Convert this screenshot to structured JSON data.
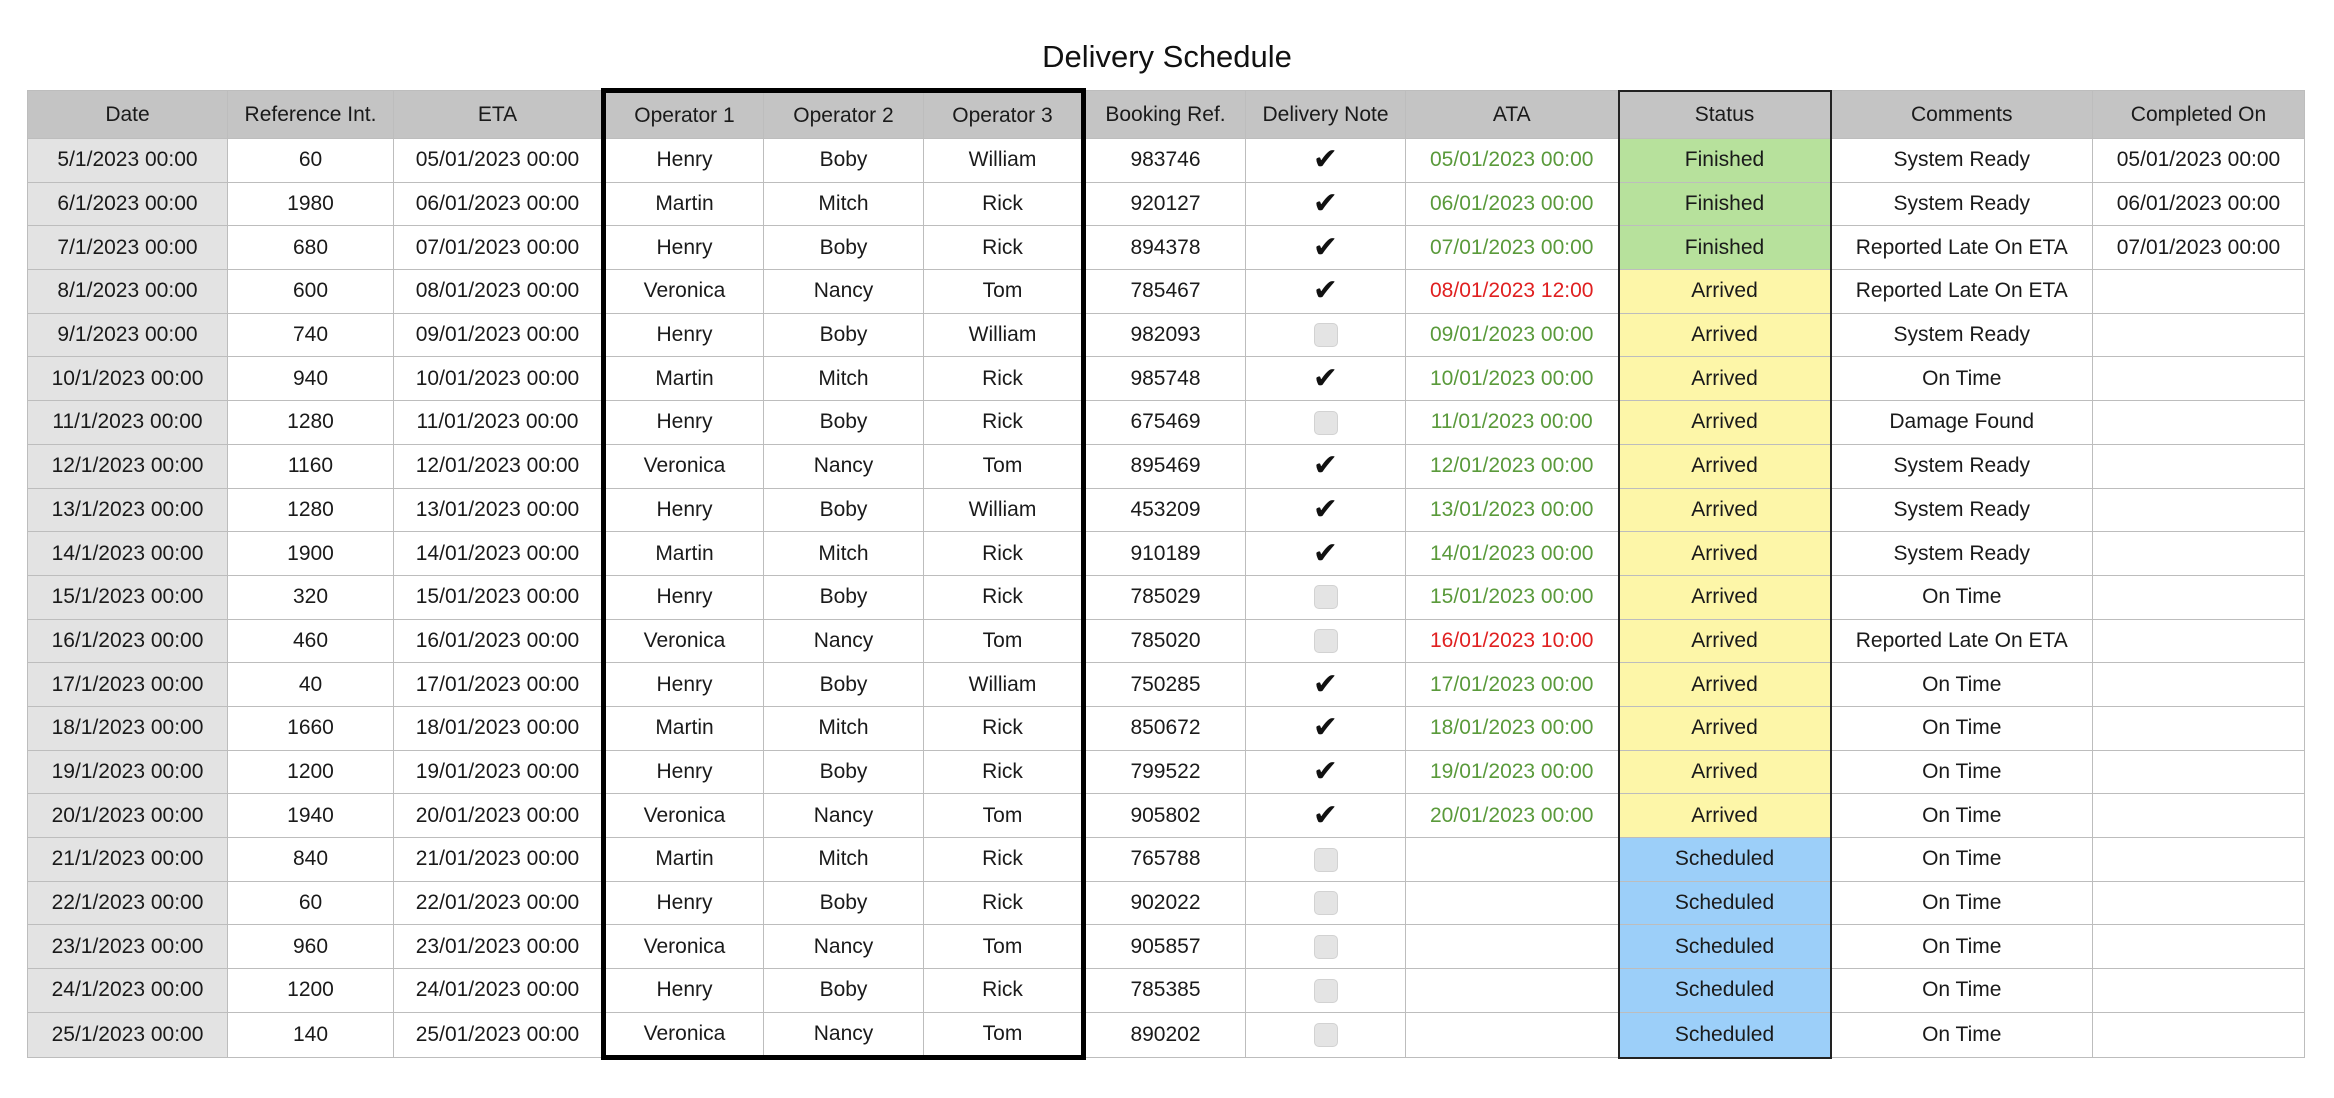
{
  "title": "Delivery Schedule",
  "columns": [
    "Date",
    "Reference Int.",
    "ETA",
    "Operator 1",
    "Operator 2",
    "Operator 3",
    "Booking Ref.",
    "Delivery Note",
    "ATA",
    "Status",
    "Comments",
    "Completed On"
  ],
  "status_colors": {
    "Finished": "#b7e19c",
    "Arrived": "#fdf6a8",
    "Scheduled": "#9ccff9"
  },
  "ata_colors": {
    "ontime": "#5a9a3b",
    "late": "#e02020"
  },
  "rows": [
    {
      "date": "5/1/2023 00:00",
      "ref": "60",
      "eta": "05/01/2023 00:00",
      "op1": "Henry",
      "op2": "Boby",
      "op3": "William",
      "booking": "983746",
      "note": true,
      "ata": "05/01/2023 00:00",
      "ata_state": "ontime",
      "status": "Finished",
      "comment": "System Ready",
      "completed": "05/01/2023 00:00"
    },
    {
      "date": "6/1/2023 00:00",
      "ref": "1980",
      "eta": "06/01/2023 00:00",
      "op1": "Martin",
      "op2": "Mitch",
      "op3": "Rick",
      "booking": "920127",
      "note": true,
      "ata": "06/01/2023 00:00",
      "ata_state": "ontime",
      "status": "Finished",
      "comment": "System Ready",
      "completed": "06/01/2023 00:00"
    },
    {
      "date": "7/1/2023 00:00",
      "ref": "680",
      "eta": "07/01/2023 00:00",
      "op1": "Henry",
      "op2": "Boby",
      "op3": "Rick",
      "booking": "894378",
      "note": true,
      "ata": "07/01/2023 00:00",
      "ata_state": "ontime",
      "status": "Finished",
      "comment": "Reported Late On ETA",
      "completed": "07/01/2023 00:00"
    },
    {
      "date": "8/1/2023 00:00",
      "ref": "600",
      "eta": "08/01/2023 00:00",
      "op1": "Veronica",
      "op2": "Nancy",
      "op3": "Tom",
      "booking": "785467",
      "note": true,
      "ata": "08/01/2023 12:00",
      "ata_state": "late",
      "status": "Arrived",
      "comment": "Reported Late On ETA",
      "completed": ""
    },
    {
      "date": "9/1/2023 00:00",
      "ref": "740",
      "eta": "09/01/2023 00:00",
      "op1": "Henry",
      "op2": "Boby",
      "op3": "William",
      "booking": "982093",
      "note": false,
      "ata": "09/01/2023 00:00",
      "ata_state": "ontime",
      "status": "Arrived",
      "comment": "System Ready",
      "completed": ""
    },
    {
      "date": "10/1/2023 00:00",
      "ref": "940",
      "eta": "10/01/2023 00:00",
      "op1": "Martin",
      "op2": "Mitch",
      "op3": "Rick",
      "booking": "985748",
      "note": true,
      "ata": "10/01/2023 00:00",
      "ata_state": "ontime",
      "status": "Arrived",
      "comment": "On Time",
      "completed": ""
    },
    {
      "date": "11/1/2023 00:00",
      "ref": "1280",
      "eta": "11/01/2023 00:00",
      "op1": "Henry",
      "op2": "Boby",
      "op3": "Rick",
      "booking": "675469",
      "note": false,
      "ata": "11/01/2023 00:00",
      "ata_state": "ontime",
      "status": "Arrived",
      "comment": "Damage Found",
      "completed": ""
    },
    {
      "date": "12/1/2023 00:00",
      "ref": "1160",
      "eta": "12/01/2023 00:00",
      "op1": "Veronica",
      "op2": "Nancy",
      "op3": "Tom",
      "booking": "895469",
      "note": true,
      "ata": "12/01/2023 00:00",
      "ata_state": "ontime",
      "status": "Arrived",
      "comment": "System Ready",
      "completed": ""
    },
    {
      "date": "13/1/2023 00:00",
      "ref": "1280",
      "eta": "13/01/2023 00:00",
      "op1": "Henry",
      "op2": "Boby",
      "op3": "William",
      "booking": "453209",
      "note": true,
      "ata": "13/01/2023 00:00",
      "ata_state": "ontime",
      "status": "Arrived",
      "comment": "System Ready",
      "completed": ""
    },
    {
      "date": "14/1/2023 00:00",
      "ref": "1900",
      "eta": "14/01/2023 00:00",
      "op1": "Martin",
      "op2": "Mitch",
      "op3": "Rick",
      "booking": "910189",
      "note": true,
      "ata": "14/01/2023 00:00",
      "ata_state": "ontime",
      "status": "Arrived",
      "comment": "System Ready",
      "completed": ""
    },
    {
      "date": "15/1/2023 00:00",
      "ref": "320",
      "eta": "15/01/2023 00:00",
      "op1": "Henry",
      "op2": "Boby",
      "op3": "Rick",
      "booking": "785029",
      "note": false,
      "ata": "15/01/2023 00:00",
      "ata_state": "ontime",
      "status": "Arrived",
      "comment": "On Time",
      "completed": ""
    },
    {
      "date": "16/1/2023 00:00",
      "ref": "460",
      "eta": "16/01/2023 00:00",
      "op1": "Veronica",
      "op2": "Nancy",
      "op3": "Tom",
      "booking": "785020",
      "note": false,
      "ata": "16/01/2023 10:00",
      "ata_state": "late",
      "status": "Arrived",
      "comment": "Reported Late On ETA",
      "completed": ""
    },
    {
      "date": "17/1/2023 00:00",
      "ref": "40",
      "eta": "17/01/2023 00:00",
      "op1": "Henry",
      "op2": "Boby",
      "op3": "William",
      "booking": "750285",
      "note": true,
      "ata": "17/01/2023 00:00",
      "ata_state": "ontime",
      "status": "Arrived",
      "comment": "On Time",
      "completed": ""
    },
    {
      "date": "18/1/2023 00:00",
      "ref": "1660",
      "eta": "18/01/2023 00:00",
      "op1": "Martin",
      "op2": "Mitch",
      "op3": "Rick",
      "booking": "850672",
      "note": true,
      "ata": "18/01/2023 00:00",
      "ata_state": "ontime",
      "status": "Arrived",
      "comment": "On Time",
      "completed": ""
    },
    {
      "date": "19/1/2023 00:00",
      "ref": "1200",
      "eta": "19/01/2023 00:00",
      "op1": "Henry",
      "op2": "Boby",
      "op3": "Rick",
      "booking": "799522",
      "note": true,
      "ata": "19/01/2023 00:00",
      "ata_state": "ontime",
      "status": "Arrived",
      "comment": "On Time",
      "completed": ""
    },
    {
      "date": "20/1/2023 00:00",
      "ref": "1940",
      "eta": "20/01/2023 00:00",
      "op1": "Veronica",
      "op2": "Nancy",
      "op3": "Tom",
      "booking": "905802",
      "note": true,
      "ata": "20/01/2023 00:00",
      "ata_state": "ontime",
      "status": "Arrived",
      "comment": "On Time",
      "completed": ""
    },
    {
      "date": "21/1/2023 00:00",
      "ref": "840",
      "eta": "21/01/2023 00:00",
      "op1": "Martin",
      "op2": "Mitch",
      "op3": "Rick",
      "booking": "765788",
      "note": false,
      "ata": "",
      "ata_state": "",
      "status": "Scheduled",
      "comment": "On Time",
      "completed": ""
    },
    {
      "date": "22/1/2023 00:00",
      "ref": "60",
      "eta": "22/01/2023 00:00",
      "op1": "Henry",
      "op2": "Boby",
      "op3": "Rick",
      "booking": "902022",
      "note": false,
      "ata": "",
      "ata_state": "",
      "status": "Scheduled",
      "comment": "On Time",
      "completed": ""
    },
    {
      "date": "23/1/2023 00:00",
      "ref": "960",
      "eta": "23/01/2023 00:00",
      "op1": "Veronica",
      "op2": "Nancy",
      "op3": "Tom",
      "booking": "905857",
      "note": false,
      "ata": "",
      "ata_state": "",
      "status": "Scheduled",
      "comment": "On Time",
      "completed": ""
    },
    {
      "date": "24/1/2023 00:00",
      "ref": "1200",
      "eta": "24/01/2023 00:00",
      "op1": "Henry",
      "op2": "Boby",
      "op3": "Rick",
      "booking": "785385",
      "note": false,
      "ata": "",
      "ata_state": "",
      "status": "Scheduled",
      "comment": "On Time",
      "completed": ""
    },
    {
      "date": "25/1/2023 00:00",
      "ref": "140",
      "eta": "25/01/2023 00:00",
      "op1": "Veronica",
      "op2": "Nancy",
      "op3": "Tom",
      "booking": "890202",
      "note": false,
      "ata": "",
      "ata_state": "",
      "status": "Scheduled",
      "comment": "On Time",
      "completed": ""
    }
  ]
}
